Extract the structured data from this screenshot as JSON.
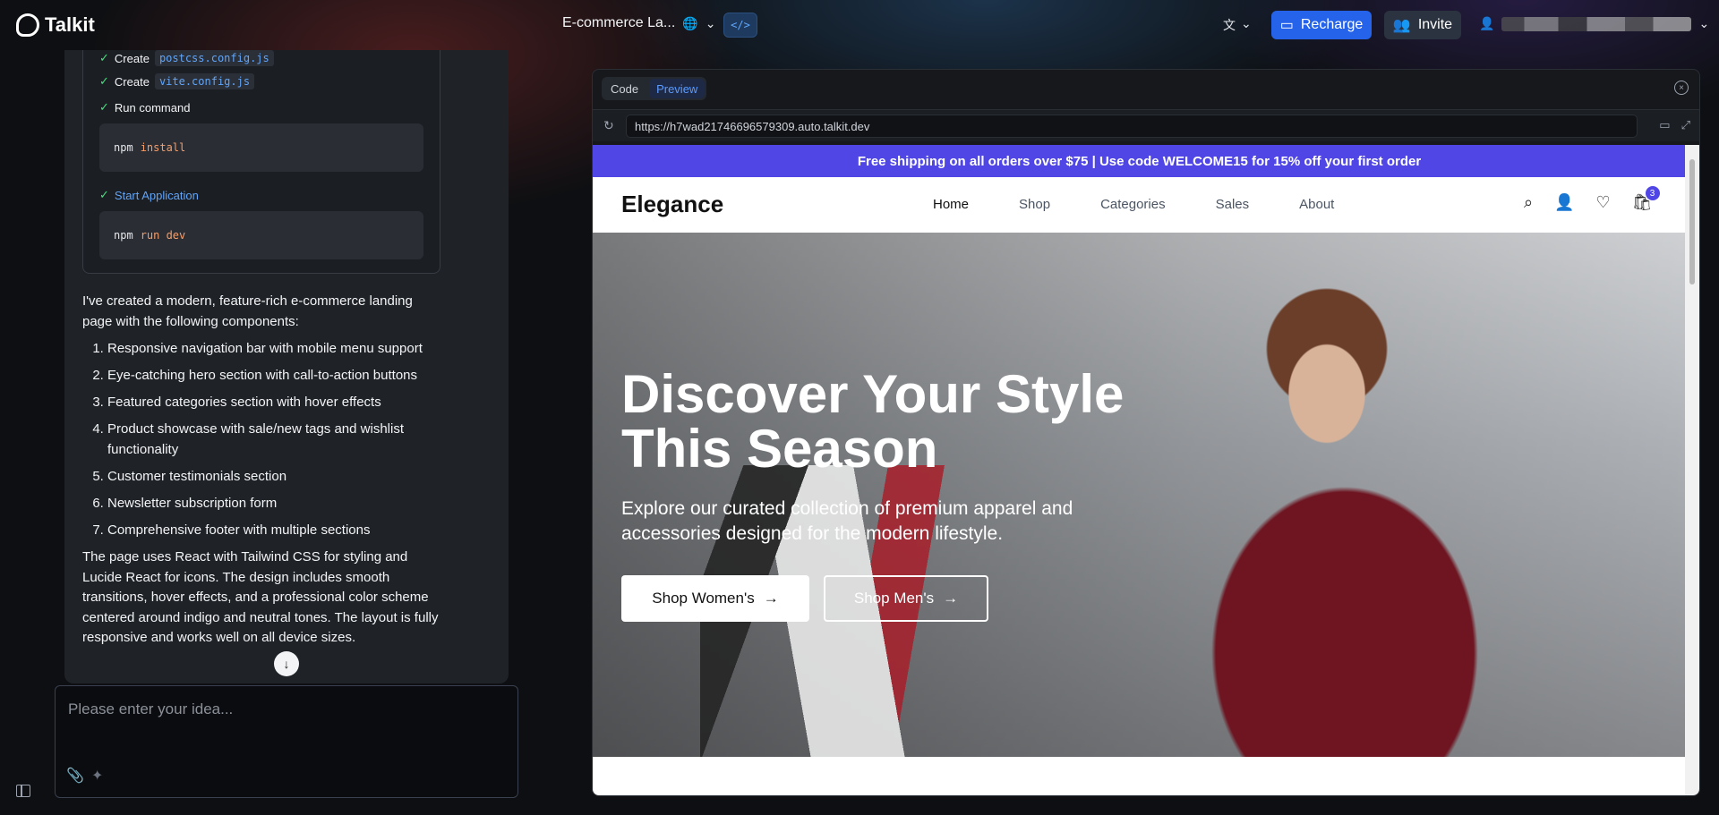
{
  "app": {
    "name": "Talkit",
    "project_title": "E-commerce La...",
    "code_toggle_label": "</>",
    "recharge_label": "Recharge",
    "invite_label": "Invite"
  },
  "chat": {
    "steps": [
      {
        "prefix": "Create",
        "file": "postcss.config.js"
      },
      {
        "prefix": "Create",
        "file": "vite.config.js"
      }
    ],
    "run_command_label": "Run command",
    "install_cmd": {
      "tool": "npm",
      "arg": "install"
    },
    "start_app_label": "Start Application",
    "dev_cmd": {
      "tool": "npm",
      "arg": "run dev"
    },
    "intro": "I've created a modern, feature-rich e-commerce landing page with the following components:",
    "features": [
      "Responsive navigation bar with mobile menu support",
      "Eye-catching hero section with call-to-action buttons",
      "Featured categories section with hover effects",
      "Product showcase with sale/new tags and wishlist functionality",
      "Customer testimonials section",
      "Newsletter subscription form",
      "Comprehensive footer with multiple sections"
    ],
    "summary": "The page uses React with Tailwind CSS for styling and Lucide React for icons. The design includes smooth transitions, hover effects, and a professional color scheme centered around indigo and neutral tones. The layout is fully responsive and works well on all device sizes.",
    "input_placeholder": "Please enter your idea..."
  },
  "preview": {
    "tabs": [
      "Code",
      "Preview"
    ],
    "active_tab": "Preview",
    "url": "https://h7wad21746696579309.auto.talkit.dev"
  },
  "site": {
    "promo": "Free shipping on all orders over $75 | Use code WELCOME15 for 15% off your first order",
    "brand": "Elegance",
    "nav": [
      "Home",
      "Shop",
      "Categories",
      "Sales",
      "About"
    ],
    "cart_count": "3",
    "hero_title_line1": "Discover Your Style",
    "hero_title_line2": "This Season",
    "hero_lead": "Explore our curated collection of premium apparel and accessories designed for the modern lifestyle.",
    "btn_women": "Shop Women's",
    "btn_men": "Shop Men's",
    "accent": "#4f46e5"
  }
}
